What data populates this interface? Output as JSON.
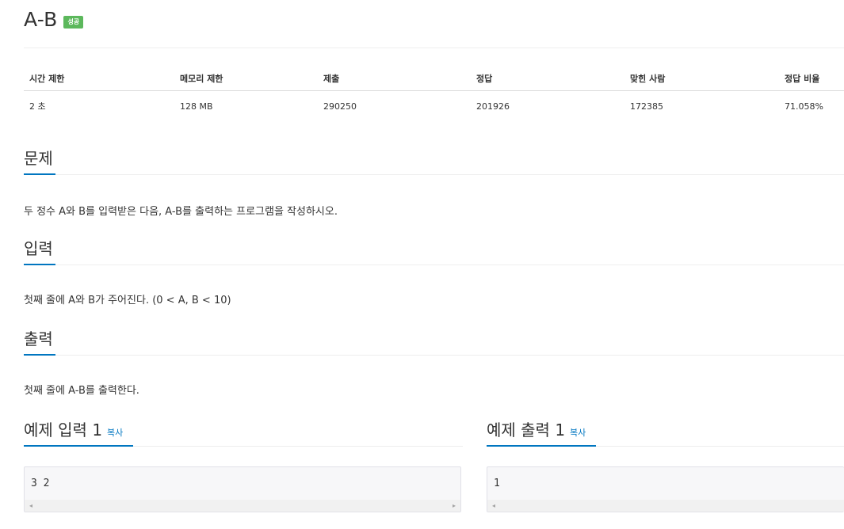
{
  "problem": {
    "title": "A-B",
    "badge": "성공"
  },
  "info_table": {
    "headers": [
      "시간 제한",
      "메모리 제한",
      "제출",
      "정답",
      "맞힌 사람",
      "정답 비율"
    ],
    "values": [
      "2 초",
      "128 MB",
      "290250",
      "201926",
      "172385",
      "71.058%"
    ]
  },
  "sections": {
    "problem": {
      "title": "문제",
      "text": "두 정수 A와 B를 입력받은 다음, A-B를 출력하는 프로그램을 작성하시오."
    },
    "input": {
      "title": "입력",
      "text": "첫째 줄에 A와 B가 주어진다. (0 < A, B < 10)"
    },
    "output": {
      "title": "출력",
      "text": "첫째 줄에 A-B를 출력한다."
    }
  },
  "samples": {
    "input": {
      "title": "예제 입력 1",
      "copy_label": "복사",
      "content": "3 2"
    },
    "output": {
      "title": "예제 출력 1",
      "copy_label": "복사",
      "content": "1"
    }
  },
  "scroll_arrows": {
    "left": "◂",
    "right": "▸"
  },
  "colors": {
    "badge": "#5cb85c",
    "accent": "#0076c0"
  }
}
